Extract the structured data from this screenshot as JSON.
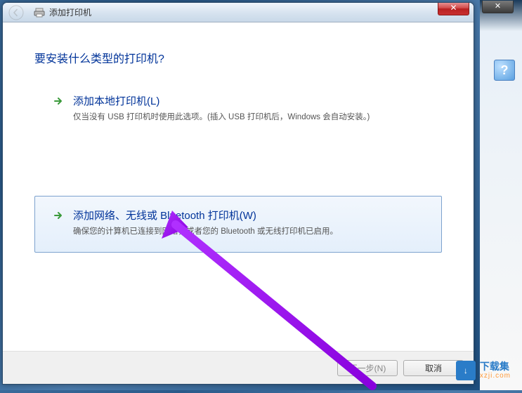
{
  "background": {
    "close_glyph": "✕",
    "help_glyph": "?"
  },
  "titlebar": {
    "title": "添加打印机",
    "close_glyph": "✕"
  },
  "heading": "要安装什么类型的打印机?",
  "options": {
    "local": {
      "title": "添加本地打印机(L)",
      "desc": "仅当没有 USB 打印机时使用此选项。(插入 USB 打印机后，Windows 会自动安装。)"
    },
    "network": {
      "title": "添加网络、无线或 Bluetooth 打印机(W)",
      "desc": "确保您的计算机已连接到网络，或者您的 Bluetooth 或无线打印机已启用。"
    }
  },
  "footer": {
    "next": "下一步(N)",
    "cancel": "取消"
  },
  "watermark": {
    "logo_glyph": "↓",
    "name": "下载集",
    "url": "xzji.com"
  }
}
